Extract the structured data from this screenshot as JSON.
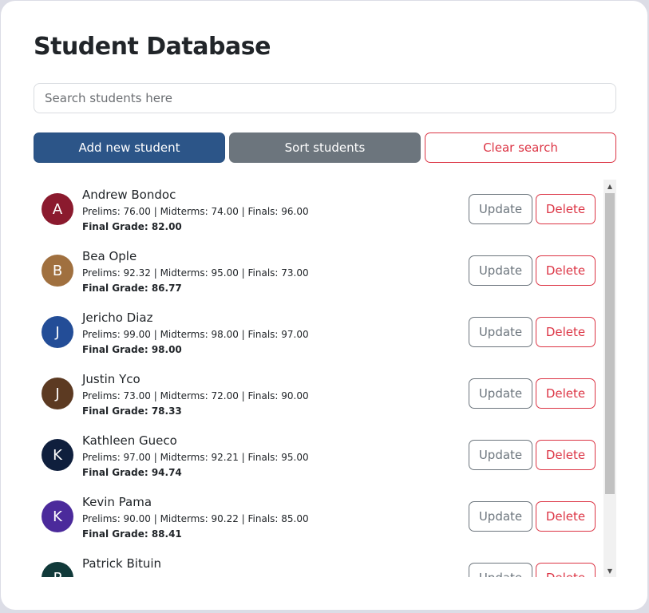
{
  "title": "Student Database",
  "search": {
    "placeholder": "Search students here",
    "value": ""
  },
  "actions": {
    "add_label": "Add new student",
    "sort_label": "Sort students",
    "clear_label": "Clear search"
  },
  "row_actions": {
    "update_label": "Update",
    "delete_label": "Delete"
  },
  "students": [
    {
      "initial": "A",
      "avatar_color": "#8b1a2e",
      "name": "Andrew Bondoc",
      "scores": "Prelims: 76.00 | Midterms: 74.00 | Finals: 96.00",
      "final": "Final Grade: 82.00"
    },
    {
      "initial": "B",
      "avatar_color": "#a0703f",
      "name": "Bea Ople",
      "scores": "Prelims: 92.32 | Midterms: 95.00 | Finals: 73.00",
      "final": "Final Grade: 86.77"
    },
    {
      "initial": "J",
      "avatar_color": "#234d97",
      "name": "Jericho Diaz",
      "scores": "Prelims: 99.00 | Midterms: 98.00 | Finals: 97.00",
      "final": "Final Grade: 98.00"
    },
    {
      "initial": "J",
      "avatar_color": "#5c3a22",
      "name": "Justin Yco",
      "scores": "Prelims: 73.00 | Midterms: 72.00 | Finals: 90.00",
      "final": "Final Grade: 78.33"
    },
    {
      "initial": "K",
      "avatar_color": "#0f1f3d",
      "name": "Kathleen Gueco",
      "scores": "Prelims: 97.00 | Midterms: 92.21 | Finals: 95.00",
      "final": "Final Grade: 94.74"
    },
    {
      "initial": "K",
      "avatar_color": "#4b2a9b",
      "name": "Kevin Pama",
      "scores": "Prelims: 90.00 | Midterms: 90.22 | Finals: 85.00",
      "final": "Final Grade: 88.41"
    },
    {
      "initial": "P",
      "avatar_color": "#113a3a",
      "name": "Patrick Bituin",
      "scores": "",
      "final": ""
    }
  ],
  "icons": {
    "scroll_up": "triangle-up-icon",
    "scroll_down": "triangle-down-icon"
  }
}
